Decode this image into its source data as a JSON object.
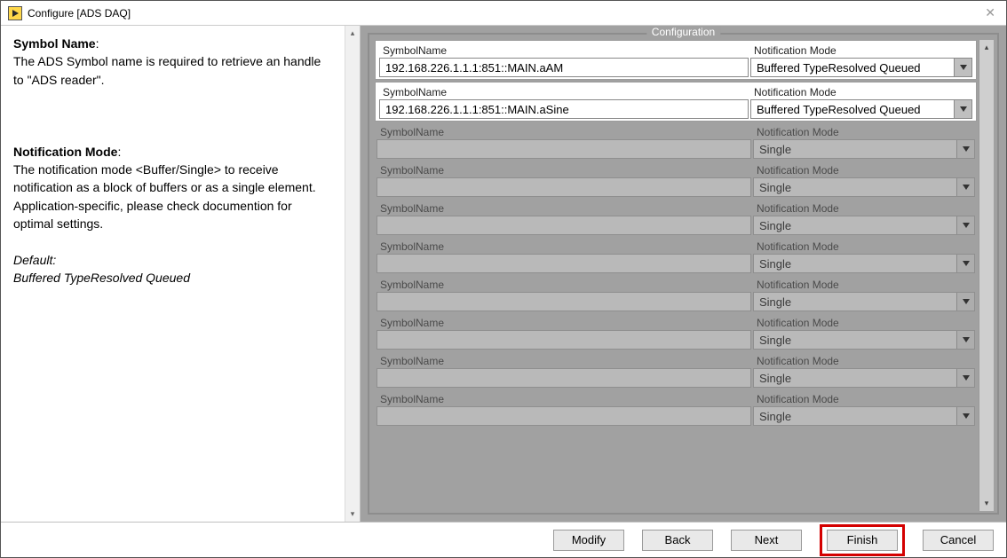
{
  "window": {
    "title": "Configure [ADS DAQ]"
  },
  "help": {
    "h1": "Symbol Name",
    "p1": "The ADS Symbol name is  required to retrieve an handle to \"ADS reader\".",
    "h2": "Notification Mode",
    "p2": "The notification mode <Buffer/Single> to receive notification as a block of buffers or as a single element. Application-specific, please check documention for optimal settings.",
    "def_label": "Default:",
    "def_value": "Buffered TypeResolved Queued"
  },
  "group": {
    "title": "Configuration"
  },
  "labels": {
    "symbol": "SymbolName",
    "mode": "Notification Mode"
  },
  "rows": [
    {
      "enabled": true,
      "symbol": "192.168.226.1.1.1:851::MAIN.aAM",
      "mode": "Buffered TypeResolved Queued"
    },
    {
      "enabled": true,
      "symbol": "192.168.226.1.1.1:851::MAIN.aSine",
      "mode": "Buffered TypeResolved Queued"
    },
    {
      "enabled": false,
      "symbol": "",
      "mode": "Single"
    },
    {
      "enabled": false,
      "symbol": "",
      "mode": "Single"
    },
    {
      "enabled": false,
      "symbol": "",
      "mode": "Single"
    },
    {
      "enabled": false,
      "symbol": "",
      "mode": "Single"
    },
    {
      "enabled": false,
      "symbol": "",
      "mode": "Single"
    },
    {
      "enabled": false,
      "symbol": "",
      "mode": "Single"
    },
    {
      "enabled": false,
      "symbol": "",
      "mode": "Single"
    },
    {
      "enabled": false,
      "symbol": "",
      "mode": "Single"
    }
  ],
  "buttons": {
    "modify": "Modify",
    "back": "Back",
    "next": "Next",
    "finish": "Finish",
    "cancel": "Cancel"
  }
}
